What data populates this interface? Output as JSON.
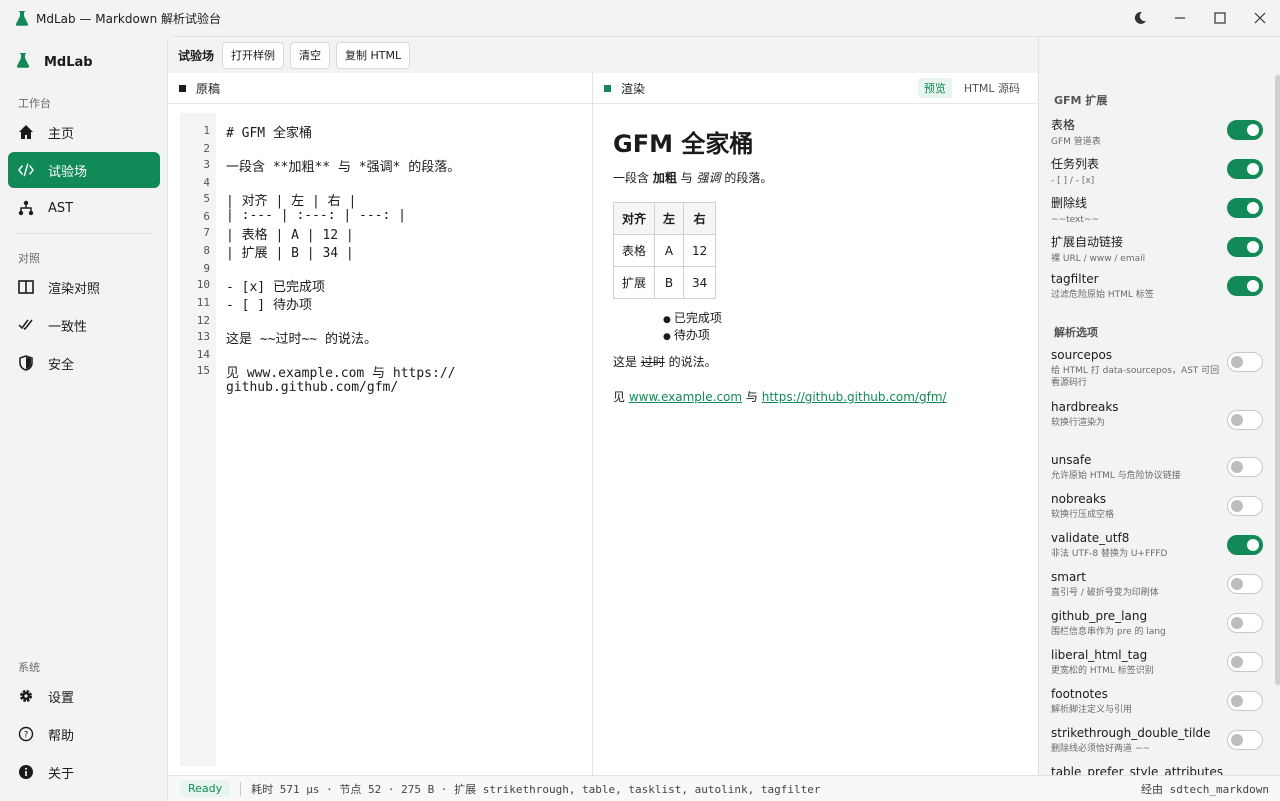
{
  "window": {
    "title": "MdLab — Markdown 解析试验台",
    "controls": [
      "moon-icon",
      "minimize-icon",
      "maximize-icon",
      "close-icon"
    ]
  },
  "sidebar": {
    "brand": "MdLab",
    "sections": [
      {
        "label": "工作台",
        "items": [
          {
            "label": "主页",
            "icon": "home-icon",
            "active": false
          },
          {
            "label": "试验场",
            "icon": "code-icon",
            "active": true
          },
          {
            "label": "AST",
            "icon": "tree-icon",
            "active": false
          }
        ]
      },
      {
        "label": "对照",
        "items": [
          {
            "label": "渲染对照",
            "icon": "split-view-icon",
            "active": false
          },
          {
            "label": "一致性",
            "icon": "double-check-icon",
            "active": false
          },
          {
            "label": "安全",
            "icon": "shield-icon",
            "active": false
          }
        ]
      },
      {
        "label": "系统",
        "items": [
          {
            "label": "设置",
            "icon": "gear-icon",
            "active": false
          },
          {
            "label": "帮助",
            "icon": "help-icon",
            "active": false
          },
          {
            "label": "关于",
            "icon": "info-icon",
            "active": false
          }
        ]
      }
    ]
  },
  "toolbar": {
    "title": "试验场",
    "buttons": [
      "打开样例",
      "清空",
      "复制 HTML"
    ]
  },
  "source": {
    "header": "原稿",
    "lines": [
      "# GFM 全家桶",
      "",
      "一段含 **加粗** 与 *强调* 的段落。",
      "",
      "| 对齐 | 左 | 右 |",
      "| :--- | :---: | ---: |",
      "| 表格 | A | 12 |",
      "| 扩展 | B | 34 |",
      "",
      "- [x] 已完成项",
      "- [ ] 待办项",
      "",
      "这是 ~~过时~~ 的说法。",
      "",
      "见 www.example.com 与 https://",
      "github.github.com/gfm/"
    ],
    "line_numbers": [
      "1",
      "2",
      "3",
      "4",
      "5",
      "6",
      "7",
      "8",
      "9",
      "10",
      "11",
      "12",
      "13",
      "14",
      "15"
    ]
  },
  "render": {
    "header": "渲染",
    "tabs": [
      {
        "label": "预览",
        "active": true
      },
      {
        "label": "HTML 源码",
        "active": false
      }
    ],
    "h1": "GFM 全家桶",
    "para1": {
      "pre": "一段含 ",
      "bold": "加粗",
      "mid": " 与 ",
      "em": "强调",
      "post": " 的段落。"
    },
    "table": {
      "headers": [
        "对齐",
        "左",
        "右"
      ],
      "rows": [
        [
          "表格",
          "A",
          "12"
        ],
        [
          "扩展",
          "B",
          "34"
        ]
      ]
    },
    "list": [
      "已完成项",
      "待办项"
    ],
    "para2": {
      "pre": "这是 ",
      "del": "过时",
      "post": " 的说法。"
    },
    "para3": {
      "pre": "见 ",
      "link1": "www.example.com",
      "mid": " 与 ",
      "link2": "https://github.github.com/gfm/"
    }
  },
  "extensions": {
    "title": "GFM 扩展",
    "items": [
      {
        "name": "表格",
        "desc": "GFM 管道表",
        "on": true
      },
      {
        "name": "任务列表",
        "desc": "- [ ] / - [x]",
        "on": true
      },
      {
        "name": "删除线",
        "desc": "~~text~~",
        "on": true
      },
      {
        "name": "扩展自动链接",
        "desc": "裸 URL / www / email",
        "on": true
      },
      {
        "name": "tagfilter",
        "desc": "过滤危险原始 HTML 标签",
        "on": true
      }
    ]
  },
  "parse_options": {
    "title": "解析选项",
    "items": [
      {
        "name": "sourcepos",
        "desc": "给 HTML 打 data-sourcepos，AST 可回看源码行",
        "on": false
      },
      {
        "name": "hardbreaks",
        "desc": "软换行渲染为",
        "on": false
      },
      {
        "name": "unsafe",
        "desc": "允许原始 HTML 与危险协议链接",
        "on": false
      },
      {
        "name": "nobreaks",
        "desc": "软换行压成空格",
        "on": false
      },
      {
        "name": "validate_utf8",
        "desc": "非法 UTF-8 替换为 U+FFFD",
        "on": true
      },
      {
        "name": "smart",
        "desc": "直引号 / 破折号变为印刷体",
        "on": false
      },
      {
        "name": "github_pre_lang",
        "desc": "围栏信息串作为 pre 的 lang",
        "on": false
      },
      {
        "name": "liberal_html_tag",
        "desc": "更宽松的 HTML 标签识别",
        "on": false
      },
      {
        "name": "footnotes",
        "desc": "解析脚注定义与引用",
        "on": false
      },
      {
        "name": "strikethrough_double_tilde",
        "desc": "删除线必须恰好两道 ~~",
        "on": false
      },
      {
        "name": "table_prefer_style_attributes",
        "desc": "",
        "on": false
      }
    ]
  },
  "status": {
    "state": "Ready",
    "text": "耗时 571 µs · 节点 52 · 275 B · 扩展 strikethrough, table, tasklist, autolink, tagfilter",
    "right": "经由 sdtech_markdown"
  },
  "colors": {
    "accent": "#118a58"
  }
}
